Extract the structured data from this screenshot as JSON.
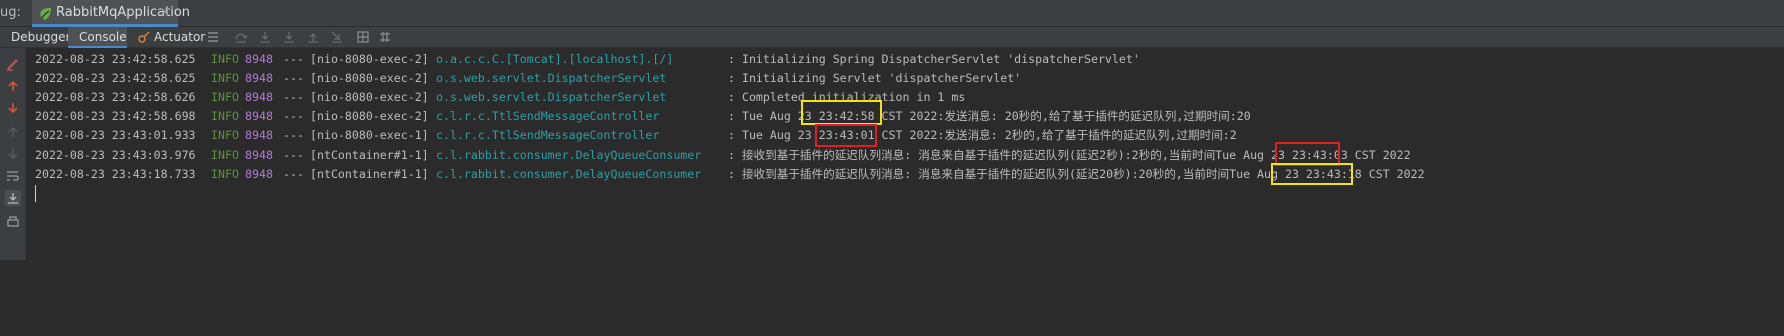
{
  "session": {
    "panel_label": "ug:",
    "run_config": "RabbitMqApplication",
    "close_glyph": "×"
  },
  "toolbar": {
    "tabs": [
      {
        "label": "Debugger"
      },
      {
        "label": "Console"
      },
      {
        "label": "Actuator"
      }
    ]
  },
  "icons": {
    "spring_boot": "spring-leaf-icon",
    "actuator": "actuator-icon",
    "accent": "#4a88c7"
  },
  "console": {
    "lines": [
      {
        "ts": "2022-08-23 23:42:58.625",
        "level": "INFO",
        "pid": "8948",
        "sep": "---",
        "thread": "[nio-8080-exec-2]",
        "logger": "o.a.c.c.C.[Tomcat].[localhost].[/]",
        "message": ": Initializing Spring DispatcherServlet 'dispatcherServlet'"
      },
      {
        "ts": "2022-08-23 23:42:58.625",
        "level": "INFO",
        "pid": "8948",
        "sep": "---",
        "thread": "[nio-8080-exec-2]",
        "logger": "o.s.web.servlet.DispatcherServlet",
        "message": ": Initializing Servlet 'dispatcherServlet'"
      },
      {
        "ts": "2022-08-23 23:42:58.626",
        "level": "INFO",
        "pid": "8948",
        "sep": "---",
        "thread": "[nio-8080-exec-2]",
        "logger": "o.s.web.servlet.DispatcherServlet",
        "message": ": Completed initialization in 1 ms"
      },
      {
        "ts": "2022-08-23 23:42:58.698",
        "level": "INFO",
        "pid": "8948",
        "sep": "---",
        "thread": "[nio-8080-exec-2]",
        "logger": "c.l.r.c.TtlSendMessageController",
        "message": ": Tue Aug 23 23:42:58 CST 2022:发送消息: 20秒的,给了基于插件的延迟队列,过期时间:20"
      },
      {
        "ts": "2022-08-23 23:43:01.933",
        "level": "INFO",
        "pid": "8948",
        "sep": "---",
        "thread": "[nio-8080-exec-1]",
        "logger": "c.l.r.c.TtlSendMessageController",
        "message": ": Tue Aug 23 23:43:01 CST 2022:发送消息: 2秒的,给了基于插件的延迟队列,过期时间:2"
      },
      {
        "ts": "2022-08-23 23:43:03.976",
        "level": "INFO",
        "pid": "8948",
        "sep": "---",
        "thread": "[ntContainer#1-1]",
        "logger": "c.l.rabbit.consumer.DelayQueueConsumer",
        "message": ": 接收到基于插件的延迟队列消息: 消息来自基于插件的延迟队列(延迟2秒):2秒的,当前时间Tue Aug 23 23:43:03 CST 2022"
      },
      {
        "ts": "2022-08-23 23:43:18.733",
        "level": "INFO",
        "pid": "8948",
        "sep": "---",
        "thread": "[ntContainer#1-1]",
        "logger": "c.l.rabbit.consumer.DelayQueueConsumer",
        "message": ": 接收到基于插件的延迟队列消息: 消息来自基于插件的延迟队列(延迟20秒):20秒的,当前时间Tue Aug 23 23:43:18 CST 2022"
      }
    ]
  },
  "annotation_colors": {
    "yellow": "#f2e40c",
    "red": "#e02020"
  }
}
